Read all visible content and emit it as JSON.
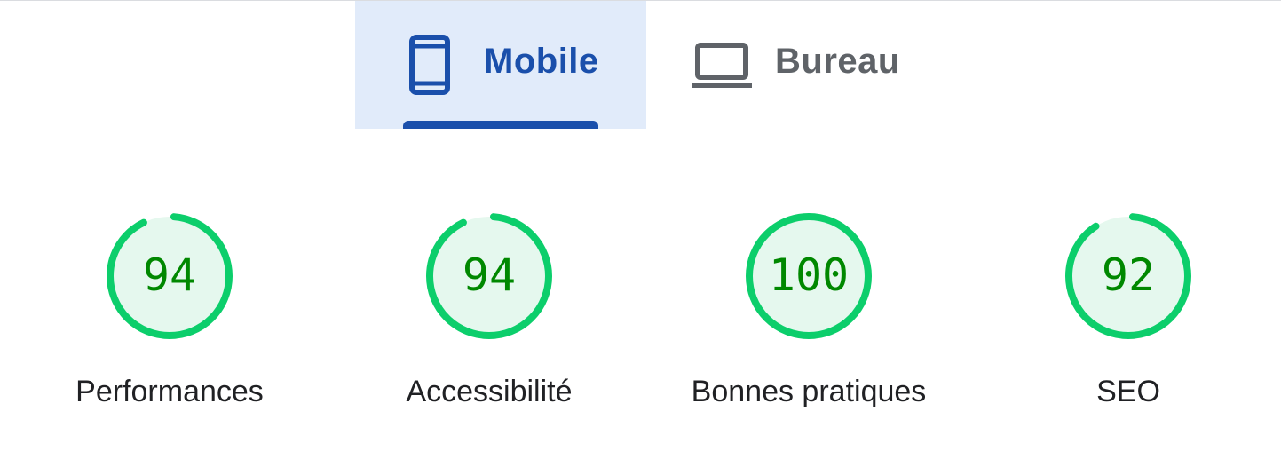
{
  "tabs": [
    {
      "label": "Mobile",
      "icon": "smartphone-icon",
      "selected": true
    },
    {
      "label": "Bureau",
      "icon": "laptop-icon",
      "selected": false
    }
  ],
  "colors": {
    "accent": "#1a4fab",
    "tab_selected_bg": "#e1ebfa",
    "tab_inactive": "#5f6368",
    "score_good": "#0cce6b",
    "score_good_fill": "#e5f8ee",
    "score_text": "#008800",
    "label_text": "#202124"
  },
  "scores": [
    {
      "category": "Performances",
      "value": "94",
      "fraction": 0.94
    },
    {
      "category": "Accessibilité",
      "value": "94",
      "fraction": 0.94
    },
    {
      "category": "Bonnes pratiques",
      "value": "100",
      "fraction": 1.0
    },
    {
      "category": "SEO",
      "value": "92",
      "fraction": 0.92
    }
  ]
}
